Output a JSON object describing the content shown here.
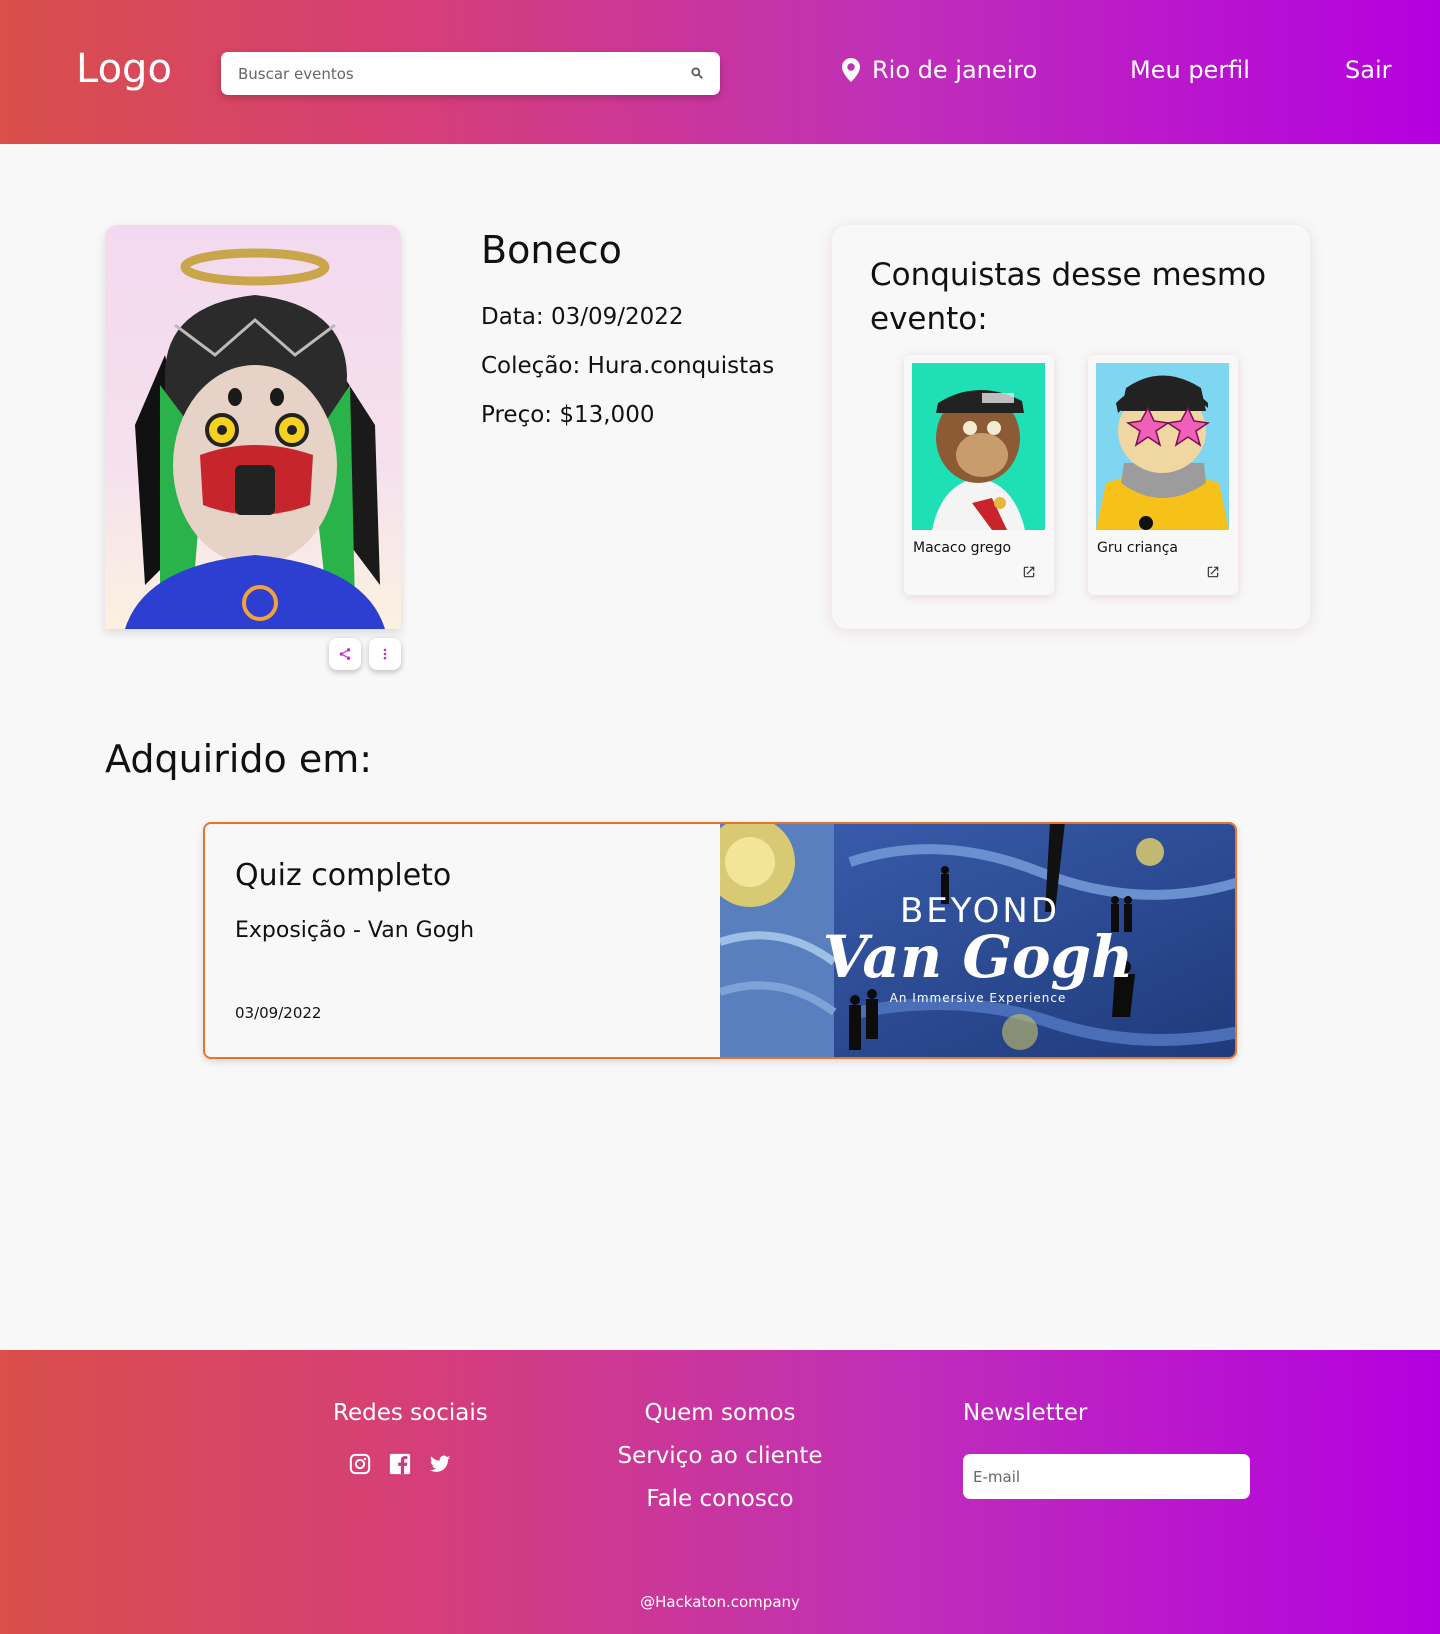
{
  "header": {
    "logo": "Logo",
    "search_placeholder": "Buscar eventos",
    "location": "Rio de janeiro",
    "profile": "Meu perfil",
    "logout": "Sair"
  },
  "nft": {
    "title": "Boneco",
    "date": "Data: 03/09/2022",
    "collection": "Coleção: Hura.conquistas",
    "price": "Preço: $13,000"
  },
  "related": {
    "title": "Conquistas desse mesmo evento:",
    "items": [
      {
        "name": "Macaco grego"
      },
      {
        "name": "Gru criança"
      }
    ]
  },
  "acquired": {
    "title": "Adquirido em:",
    "event": {
      "name": "Quiz completo",
      "subtitle": "Exposição - Van Gogh",
      "date": "03/09/2022",
      "banner_top": "BEYOND",
      "banner_main": "Van Gogh",
      "banner_tag": "An Immersive Experience"
    }
  },
  "footer": {
    "social_title": "Redes sociais",
    "links": [
      "Quem somos",
      "Serviço ao cliente",
      "Fale conosco"
    ],
    "newsletter_title": "Newsletter",
    "email_placeholder": "E-mail",
    "copyright": "@Hackaton.company"
  },
  "icons": {
    "search": "search-icon",
    "location": "location-pin-icon",
    "share": "share-icon",
    "more": "more-vertical-icon",
    "external": "external-link-icon",
    "instagram": "instagram-icon",
    "facebook": "facebook-icon",
    "twitter": "twitter-icon"
  },
  "colors": {
    "gradient_start": "#d94f4a",
    "gradient_end": "#b400e0",
    "event_border": "#e8732f",
    "accent": "#c42fc8"
  }
}
